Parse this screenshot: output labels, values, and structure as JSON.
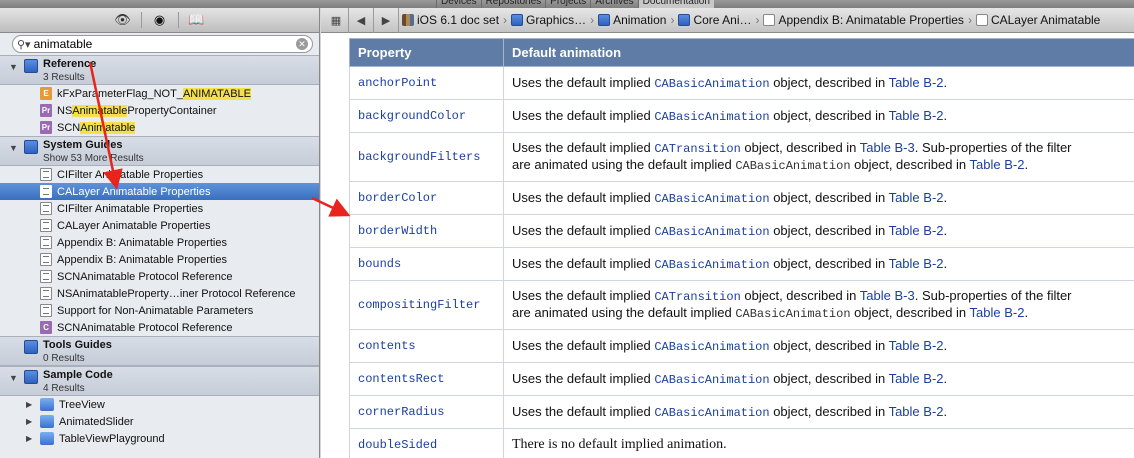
{
  "topbar": {
    "tabs": [
      "Devices",
      "Repositories",
      "Projects",
      "Archives",
      "Documentation"
    ],
    "active_tab": "Documentation"
  },
  "sidebar": {
    "toolbar_icons": [
      "eye-icon",
      "bookmark-search-icon",
      "book-icon"
    ],
    "search": {
      "value": "animatable"
    },
    "groups": [
      {
        "title": "Reference",
        "subtitle": "3 Results"
      },
      {
        "title": "System Guides",
        "subtitle": "Show 53 More Results"
      },
      {
        "title": "Tools Guides",
        "subtitle": "0 Results"
      },
      {
        "title": "Sample Code",
        "subtitle": "4 Results"
      }
    ],
    "reference_items": [
      {
        "pre": "kFxParameterFlag_NOT_",
        "hl": "ANIMATABLE",
        "post": "",
        "icon": "E"
      },
      {
        "pre": "NS",
        "hl": "Animatable",
        "post": "PropertyContainer",
        "icon": "Pr"
      },
      {
        "pre": "SCN",
        "hl": "Animatable",
        "post": "",
        "icon": "Pr"
      }
    ],
    "guide_items": [
      "CIFilter Animatable Properties",
      "CALayer Animatable Properties",
      "CIFilter Animatable Properties",
      "CALayer Animatable Properties",
      "Appendix B: Animatable Properties",
      "Appendix B: Animatable Properties",
      "SCNAnimatable Protocol Reference",
      "NSAnimatableProperty…iner Protocol Reference",
      "Support for Non-Animatable Parameters",
      "SCNAnimatable Protocol Reference"
    ],
    "sample_items": [
      "TreeView",
      "AnimatedSlider",
      "TableViewPlayground"
    ]
  },
  "jumpbar": {
    "crumbs": [
      "iOS 6.1 doc set",
      "Graphics…",
      "Animation",
      "Core Ani…",
      "Appendix B: Animatable Properties",
      "CALayer Animatable"
    ]
  },
  "table": {
    "headers": [
      "Property",
      "Default animation"
    ],
    "text": {
      "uses": "Uses the default implied ",
      "object_described": " object, described in ",
      "period": ".",
      "subprops": " Sub-properties of the filter",
      "animated_using": "are animated using the default implied ",
      "none": "There is no default implied animation."
    },
    "classes": {
      "basic": "CABasicAnimation",
      "transition": "CATransition"
    },
    "links": {
      "b2": "Table B-2",
      "b3": "Table B-3"
    },
    "rows": [
      "anchorPoint",
      "backgroundColor",
      "backgroundFilters",
      "borderColor",
      "borderWidth",
      "bounds",
      "compositingFilter",
      "contents",
      "contentsRect",
      "cornerRadius",
      "doubleSided"
    ]
  },
  "colors": {
    "header_bg": "#5f7ca6",
    "link": "#1a3fa0",
    "selection": "#3a6fc0",
    "highlight": "#f4e04c",
    "arrow": "#e8241c"
  }
}
